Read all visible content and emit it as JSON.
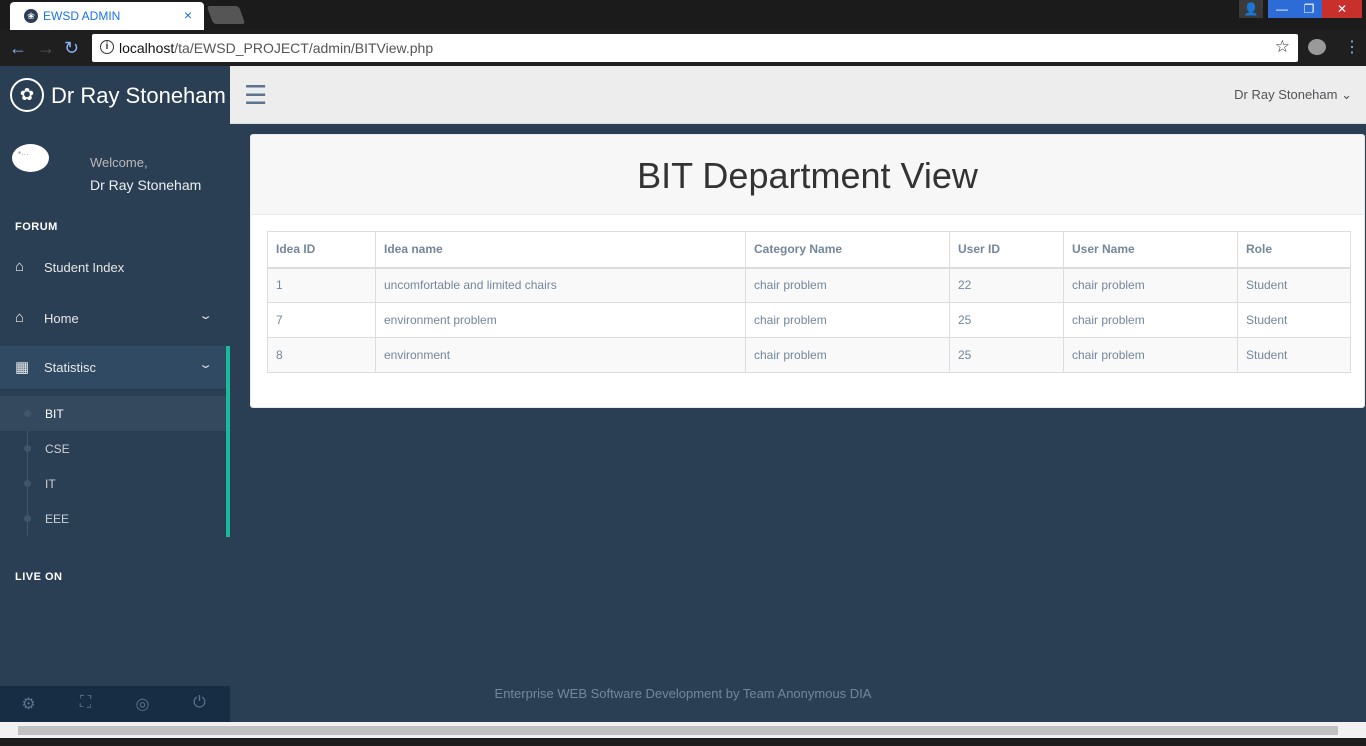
{
  "browser": {
    "tab_title": "EWSD ADMIN",
    "tab_close": "×",
    "url_host": "localhost",
    "url_path": "/ta/EWSD_PROJECT/admin/BITView.php"
  },
  "brand": {
    "name": "Dr Ray Stoneham",
    "icon": "paw-icon"
  },
  "profile": {
    "welcome": "Welcome,",
    "name": "Dr Ray Stoneham"
  },
  "sidebar": {
    "section_forum": "FORUM",
    "section_live": "LIVE ON",
    "items": [
      {
        "label": "Student Index",
        "icon": "home-icon"
      },
      {
        "label": "Home",
        "icon": "home-icon"
      },
      {
        "label": "Statistisc",
        "icon": "table-icon"
      }
    ],
    "submenu": [
      "BIT",
      "CSE",
      "IT",
      "EEE"
    ]
  },
  "topnav": {
    "user": "Dr Ray Stoneham"
  },
  "panel": {
    "title": "BIT Department View"
  },
  "table": {
    "headers": [
      "Idea ID",
      "Idea name",
      "Category Name",
      "User ID",
      "User Name",
      "Role"
    ],
    "rows": [
      [
        "1",
        "uncomfortable and limited chairs",
        "chair problem",
        "22",
        "chair problem",
        "Student"
      ],
      [
        "7",
        "environment problem",
        "chair problem",
        "25",
        "chair problem",
        "Student"
      ],
      [
        "8",
        "environment",
        "chair problem",
        "25",
        "chair problem",
        "Student"
      ]
    ]
  },
  "footer": {
    "text": "Enterprise WEB Software Development by Team Anonymous DIA"
  },
  "colors": {
    "sidebar_bg": "#2a3f54",
    "accent": "#1abb9c",
    "topnav_bg": "#ededed"
  }
}
